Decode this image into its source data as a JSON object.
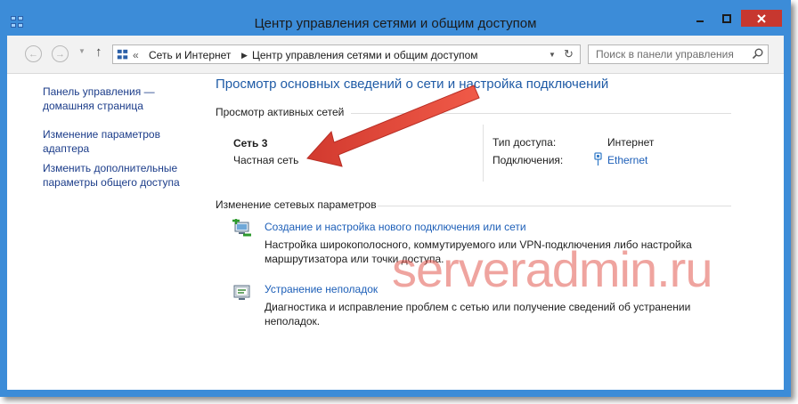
{
  "window": {
    "title": "Центр управления сетями и общим доступом"
  },
  "navbar": {
    "back_icon": "arrow-left-icon",
    "forward_icon": "arrow-right-icon",
    "breadcrumb_prefix": "«",
    "breadcrumb": [
      "Сеть и Интернет",
      "Центр управления сетями и общим доступом"
    ],
    "search_placeholder": "Поиск в панели управления"
  },
  "sidebar": {
    "links": [
      "Панель управления — домашняя страница",
      "Изменение параметров адаптера",
      "Изменить дополнительные параметры общего доступа"
    ]
  },
  "main": {
    "title": "Просмотр основных сведений о сети и настройка подключений",
    "active_networks_label": "Просмотр активных сетей",
    "network": {
      "name": "Сеть  3",
      "type": "Частная сеть",
      "access_type_label": "Тип доступа:",
      "access_type_value": "Интернет",
      "connections_label": "Подключения:",
      "connection_name": "Ethernet"
    },
    "change_settings_label": "Изменение сетевых параметров",
    "tasks": [
      {
        "title": "Создание и настройка нового подключения или сети",
        "desc_line1": "Настройка широкополосного, коммутируемого или VPN-подключения либо настройка",
        "desc_line2": "маршрутизатора или точки доступа."
      },
      {
        "title": "Устранение неполадок",
        "desc_line1": "Диагностика и исправление проблем с сетью или получение сведений об устранении",
        "desc_line2": "неполадок."
      }
    ]
  },
  "watermark": "serveradmin.ru",
  "colors": {
    "frame": "#3c8cd8",
    "close_button": "#c7372f",
    "link": "#1d5fb8",
    "heading": "#1f5ba6",
    "annotation_arrow": "#e0463a"
  }
}
